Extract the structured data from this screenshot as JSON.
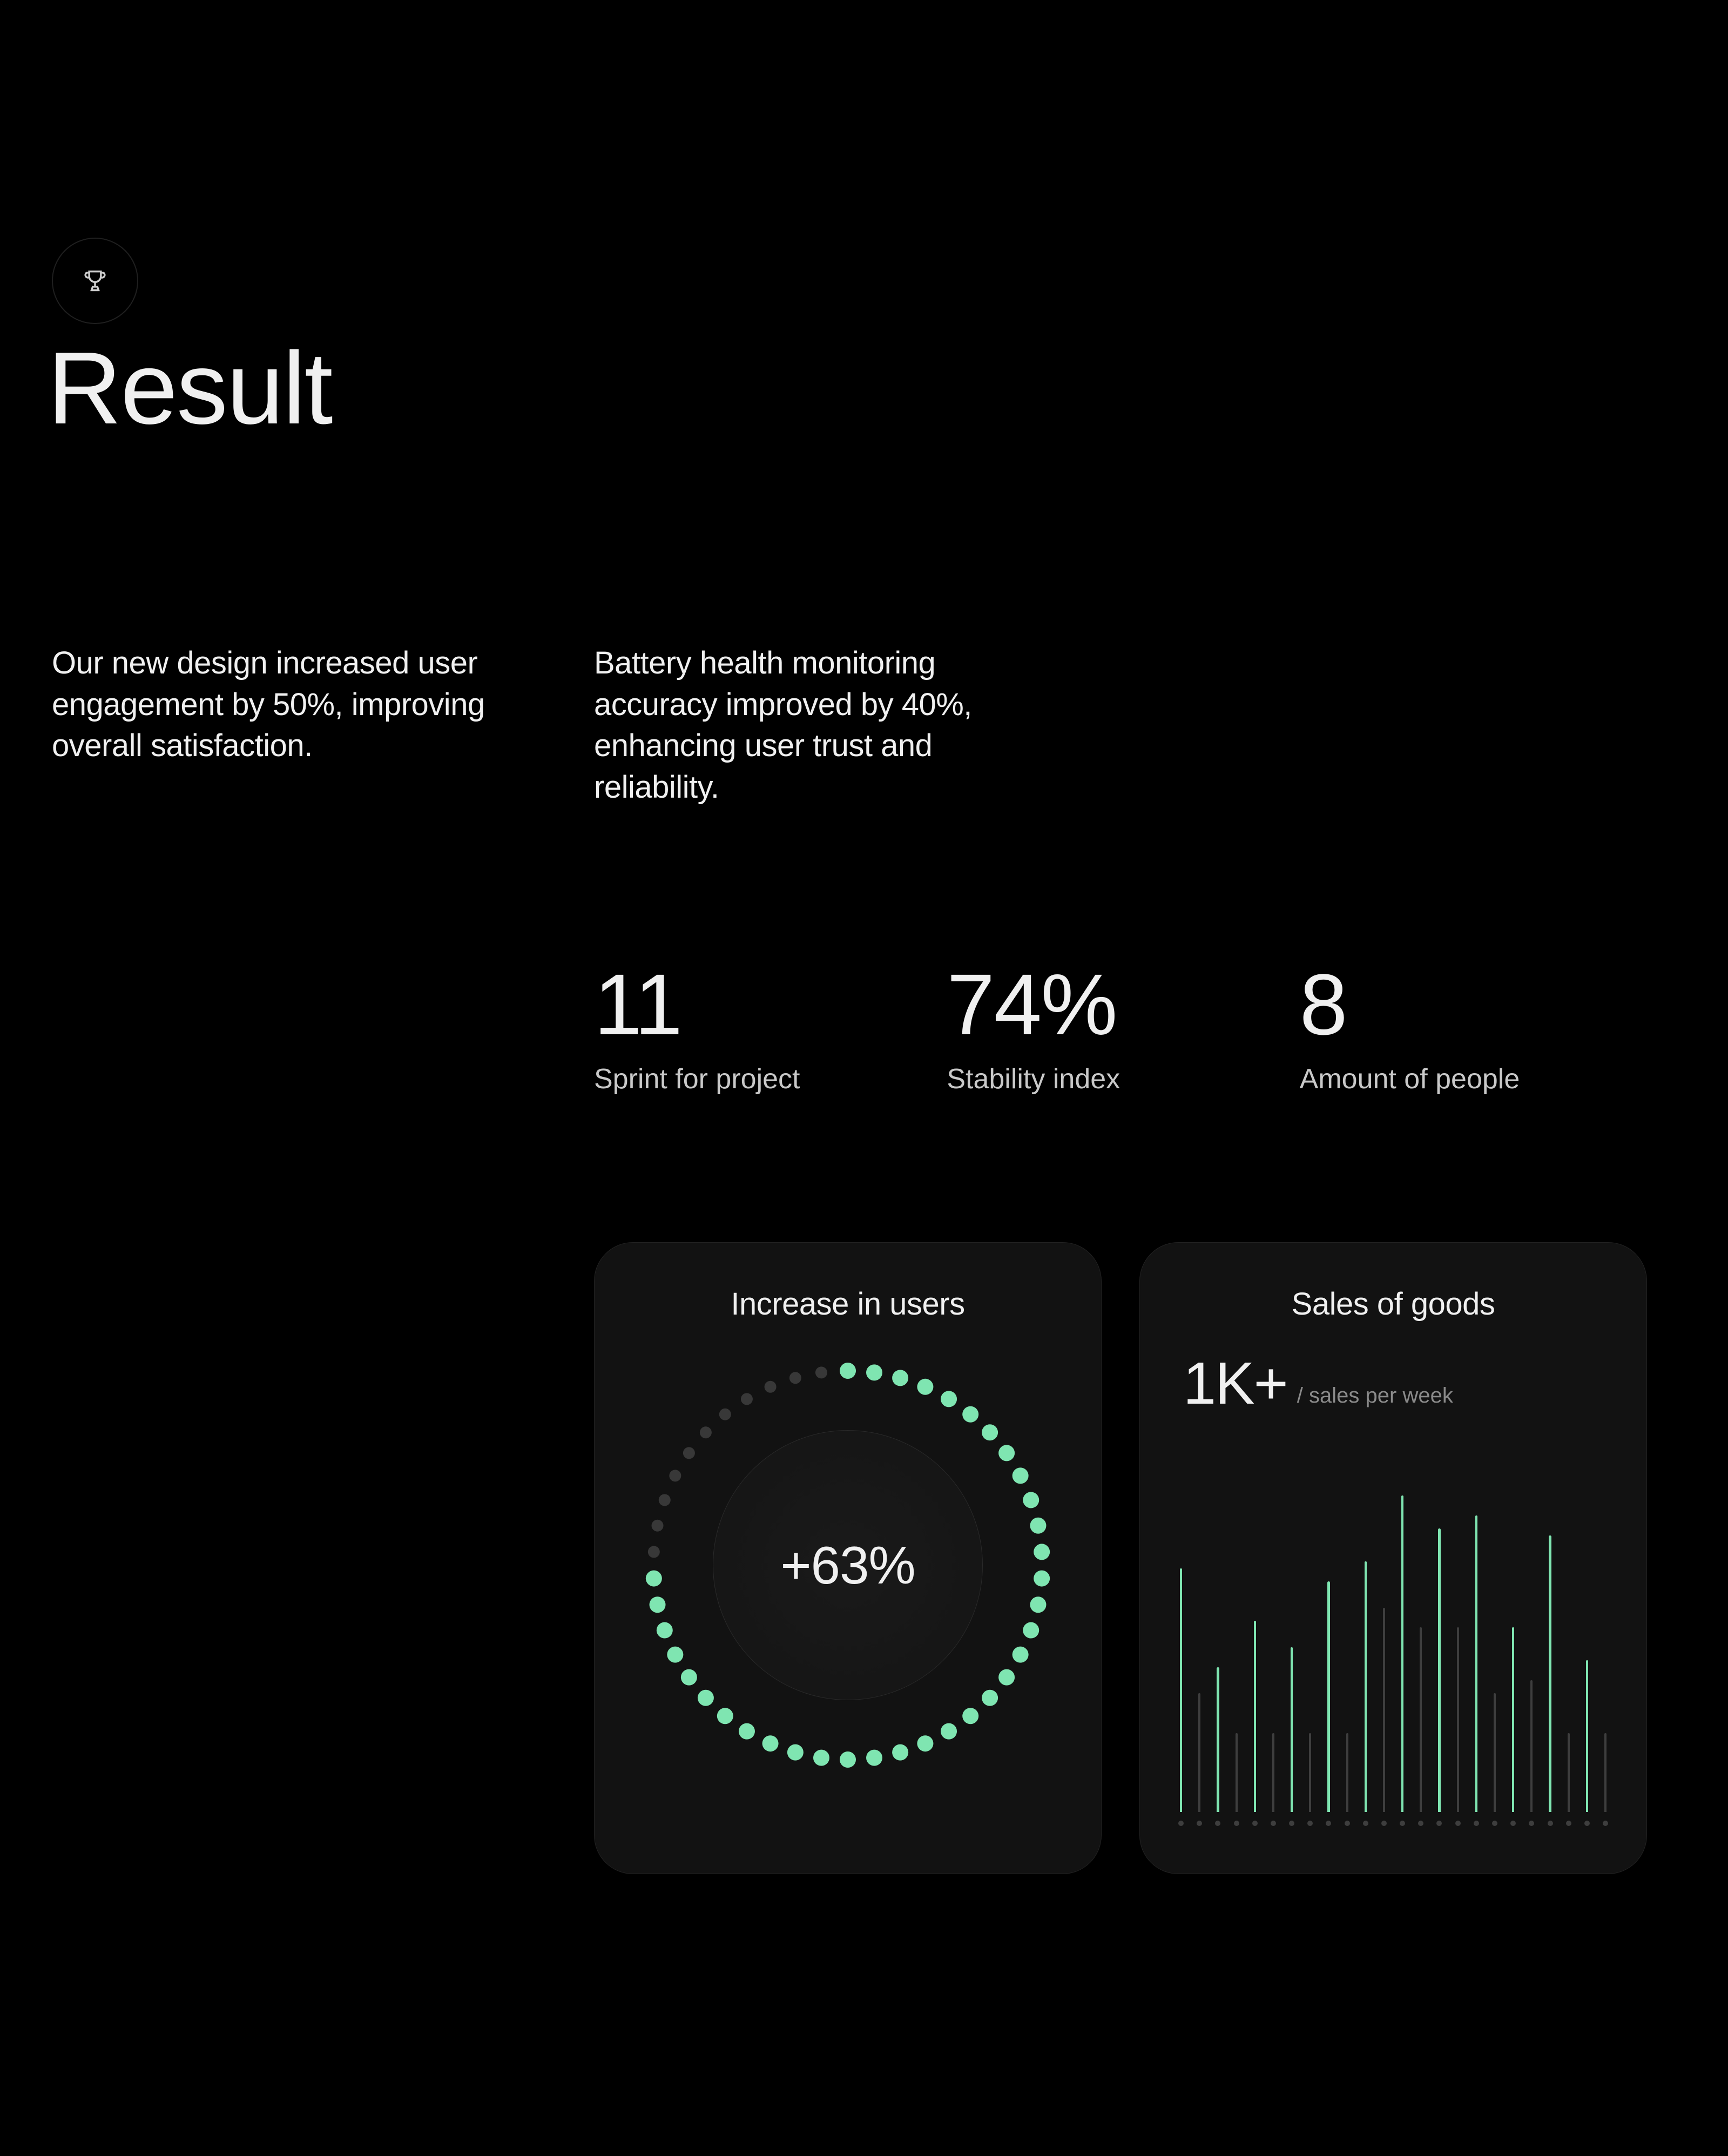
{
  "header": {
    "icon": "trophy-icon",
    "title": "Result"
  },
  "paragraphs": [
    "Our new design increased user engagement by 50%, improving overall satisfaction.",
    "Battery health monitoring accuracy improved by 40%, enhancing user trust and reliability."
  ],
  "stats": [
    {
      "value": "11",
      "label": "Sprint for project"
    },
    {
      "value": "74%",
      "label": "Stability index"
    },
    {
      "value": "8",
      "label": "Amount of people"
    }
  ],
  "cards": {
    "users": {
      "title": "Increase in users",
      "center": "+63%",
      "progress_fraction": 0.75,
      "dot_count": 46
    },
    "sales": {
      "title": "Sales of goods",
      "headline": "1K+",
      "per": "/ sales per week"
    }
  },
  "colors": {
    "accent": "#7fe5b1",
    "bg": "#000000",
    "card": "#121212",
    "muted": "#8a8a8a",
    "dim_bar": "#3e3e3e"
  },
  "chart_data": [
    {
      "type": "bar",
      "title": "Sales of goods",
      "xlabel": "",
      "ylabel": "",
      "ylim": [
        0,
        100
      ],
      "series": [
        {
          "name": "accent",
          "values": [
            74,
            44,
            58,
            50,
            70,
            76,
            96,
            86,
            90,
            56,
            84,
            46
          ]
        },
        {
          "name": "dim",
          "values": [
            36,
            24,
            24,
            24,
            24,
            62,
            56,
            56,
            36,
            40,
            24,
            24
          ]
        }
      ]
    },
    {
      "type": "pie",
      "title": "Increase in users",
      "categories": [
        "increase",
        "remaining"
      ],
      "values": [
        63,
        37
      ],
      "annotations": [
        "+63%"
      ]
    }
  ]
}
